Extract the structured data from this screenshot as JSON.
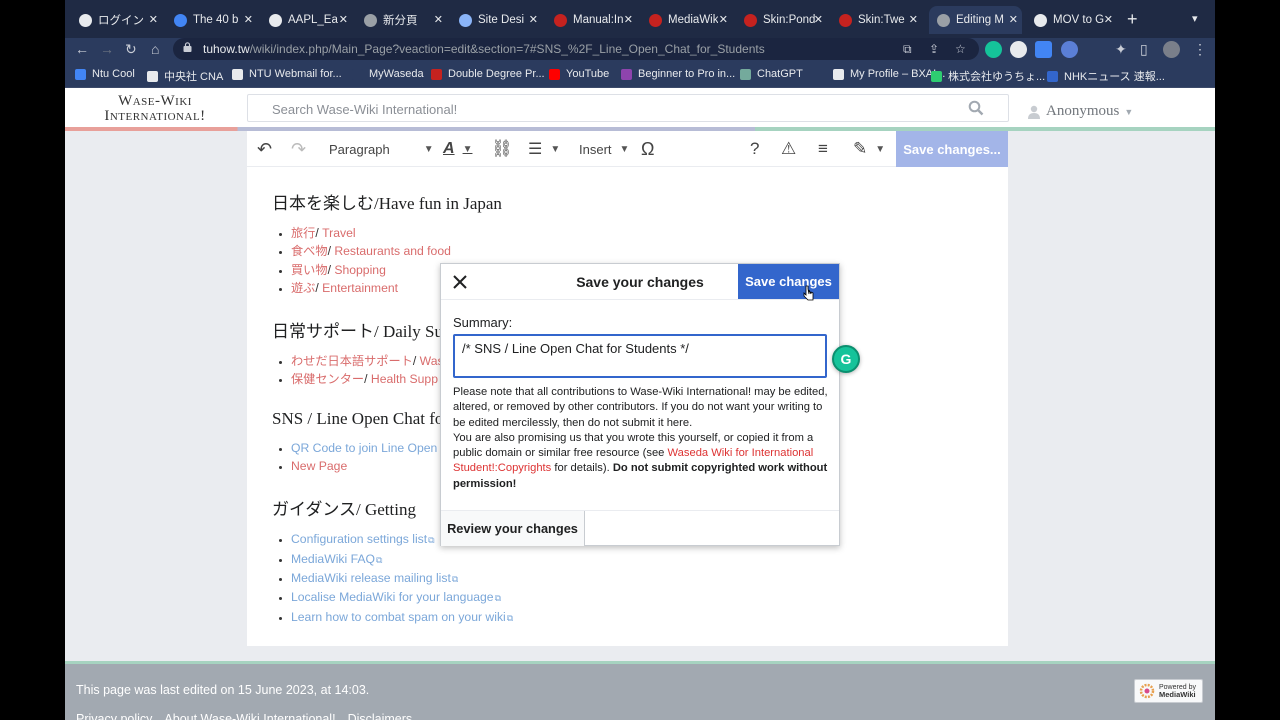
{
  "browser": {
    "tabs": [
      {
        "label": "ログイン",
        "color": "#e8eaed"
      },
      {
        "label": "The 40 b",
        "color": "#4285f4"
      },
      {
        "label": "AAPL_Ea",
        "color": "#e8eaed"
      },
      {
        "label": "新分頁",
        "color": "#9aa0a6"
      },
      {
        "label": "Site Desi",
        "color": "#8ab4f8"
      },
      {
        "label": "Manual:In",
        "color": "#c5221f"
      },
      {
        "label": "MediaWik",
        "color": "#c5221f"
      },
      {
        "label": "Skin:Pond",
        "color": "#c5221f"
      },
      {
        "label": "Skin:Twe",
        "color": "#c5221f"
      },
      {
        "label": "Editing M",
        "color": "#9aa0a6",
        "active": true
      },
      {
        "label": "MOV to G",
        "color": "#e8eaed"
      }
    ],
    "url_host": "tuhow.tw",
    "url_path": "/wiki/index.php/Main_Page?veaction=edit&section=7#SNS_%2F_Line_Open_Chat_for_Students",
    "bookmarks": [
      {
        "label": "Ntu Cool",
        "color": "#4285f4"
      },
      {
        "label": "中央社 CNA",
        "color": "#e8eaed"
      },
      {
        "label": "NTU Webmail for...",
        "color": "#e8eaed"
      },
      {
        "label": "MyWaseda",
        "color": "#2b3b5e"
      },
      {
        "label": "Double Degree Pr...",
        "color": "#c5221f"
      },
      {
        "label": "YouTube",
        "color": "#ff0000"
      },
      {
        "label": "Beginner to Pro in...",
        "color": "#8e44ad"
      },
      {
        "label": "ChatGPT",
        "color": "#74aa9c"
      },
      {
        "label": "My Profile – BXAI...",
        "color": "#e8eaed"
      },
      {
        "label": "株式会社ゆうちょ...",
        "color": "#2ecc71"
      },
      {
        "label": "NHKニュース 速報...",
        "color": "#3366cc"
      }
    ]
  },
  "wiki": {
    "logo_line1": "Wase-Wiki",
    "logo_line2": "International!",
    "search_placeholder": "Search Wase-Wiki International!",
    "user_label": "Anonymous"
  },
  "toolbar": {
    "paragraph": "Paragraph",
    "insert": "Insert",
    "save": "Save changes..."
  },
  "content": {
    "sections": [
      {
        "heading": "日本を楽しむ/Have fun in Japan",
        "items": [
          {
            "jp": "旅行",
            "en": "Travel"
          },
          {
            "jp": "食べ物",
            "en": "Restaurants and food"
          },
          {
            "jp": "買い物",
            "en": "Shopping"
          },
          {
            "jp": "遊ぶ",
            "en": "Entertainment"
          }
        ]
      },
      {
        "heading": "日常サポート/ Daily Su",
        "items": [
          {
            "jp": "わせだ日本語サポート",
            "en": "Was"
          },
          {
            "jp": "保健センター",
            "en": "Health Supp"
          }
        ]
      },
      {
        "heading": "SNS / Line Open Chat fo",
        "items": [
          {
            "text": "QR Code to join Line Open",
            "style": "blue"
          },
          {
            "text": "New Page",
            "style": "red"
          }
        ]
      },
      {
        "heading": "ガイダンス/ Getting",
        "items": [
          {
            "text": "Configuration settings list",
            "style": "blue",
            "external": true
          },
          {
            "text": "MediaWiki FAQ",
            "style": "blue",
            "external": true
          },
          {
            "text": "MediaWiki release mailing list",
            "style": "blue",
            "external": true
          },
          {
            "text": "Localise MediaWiki for your language",
            "style": "blue",
            "external": true
          },
          {
            "text": "Learn how to combat spam on your wiki",
            "style": "blue",
            "external": true
          }
        ]
      }
    ]
  },
  "dialog": {
    "title": "Save your changes",
    "save_label": "Save changes",
    "summary_label": "Summary:",
    "summary_value": "/* SNS / Line Open Chat for Students */",
    "notice_1": "Please note that all contributions to Wase-Wiki International! may be edited, altered, or removed by other contributors. If you do not want your writing to be edited mercilessly, then do not submit it here.",
    "notice_2": "You are also promising us that you wrote this yourself, or copied it from a public domain or similar free resource (see ",
    "notice_link": "Waseda Wiki for International Student!:Copyrights",
    "notice_3": " for details). ",
    "notice_bold": "Do not submit copyrighted work without permission!",
    "review_label": "Review your changes"
  },
  "footer": {
    "last_edited": "This page was last edited on 15 June 2023, at 14:03.",
    "links": [
      "Privacy policy",
      "About Wase-Wiki International!",
      "Disclaimers"
    ],
    "powered_line1": "Powered by",
    "powered_line2": "MediaWiki"
  }
}
